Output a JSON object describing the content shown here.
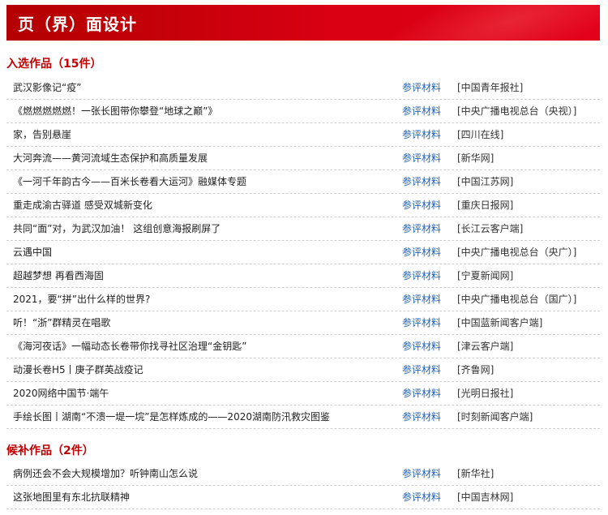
{
  "header": {
    "title": "页（界）面设计"
  },
  "sections": [
    {
      "title": "入选作品（15件）",
      "items": [
        {
          "name": "武汉影像记“疫”",
          "ref": "参评材料",
          "source": "[中国青年报社]"
        },
        {
          "name": "《燃燃燃燃燃！一张长图带你攀登“地球之巅”》",
          "ref": "参评材料",
          "source": "[中央广播电视总台（央视）]"
        },
        {
          "name": "家，告别悬崖",
          "ref": "参评材料",
          "source": "[四川在线]"
        },
        {
          "name": "大河奔流——黄河流域生态保护和高质量发展",
          "ref": "参评材料",
          "source": "[新华网]"
        },
        {
          "name": "《一河千年韵古今——百米长卷看大运河》融媒体专题",
          "ref": "参评材料",
          "source": "[中国江苏网]"
        },
        {
          "name": "重走成渝古驿道 感受双城新变化",
          "ref": "参评材料",
          "source": "[重庆日报网]"
        },
        {
          "name": "共同“面”对，为武汉加油！ 这组创意海报刷屏了",
          "ref": "参评材料",
          "source": "[长江云客户端]"
        },
        {
          "name": "云遇中国",
          "ref": "参评材料",
          "source": "[中央广播电视总台（央广）]"
        },
        {
          "name": "超越梦想 再看西海固",
          "ref": "参评材料",
          "source": "[宁夏新闻网]"
        },
        {
          "name": "2021，要“拼”出什么样的世界?",
          "ref": "参评材料",
          "source": "[中央广播电视总台（国广）]"
        },
        {
          "name": "听！“浙”群精灵在唱歌",
          "ref": "参评材料",
          "source": "[中国蓝新闻客户端]"
        },
        {
          "name": "《海河夜话》一幅动态长卷带你找寻社区治理“金钥匙”",
          "ref": "参评材料",
          "source": "[津云客户端]"
        },
        {
          "name": "动漫长卷H5丨庚子群英战疫记",
          "ref": "参评材料",
          "source": "[齐鲁网]"
        },
        {
          "name": "2020网络中国节·端午",
          "ref": "参评材料",
          "source": "[光明日报社]"
        },
        {
          "name": "手绘长图丨湖南“不溃一堤一垸”是怎样炼成的——2020湖南防汛救灾图鉴",
          "ref": "参评材料",
          "source": "[时刻新闻客户端]"
        }
      ]
    },
    {
      "title": "候补作品（2件）",
      "items": [
        {
          "name": "病例还会不会大规模增加？听钟南山怎么说",
          "ref": "参评材料",
          "source": "[新华社]"
        },
        {
          "name": "这张地图里有东北抗联精神",
          "ref": "参评材料",
          "source": "[中国吉林网]"
        }
      ]
    }
  ]
}
